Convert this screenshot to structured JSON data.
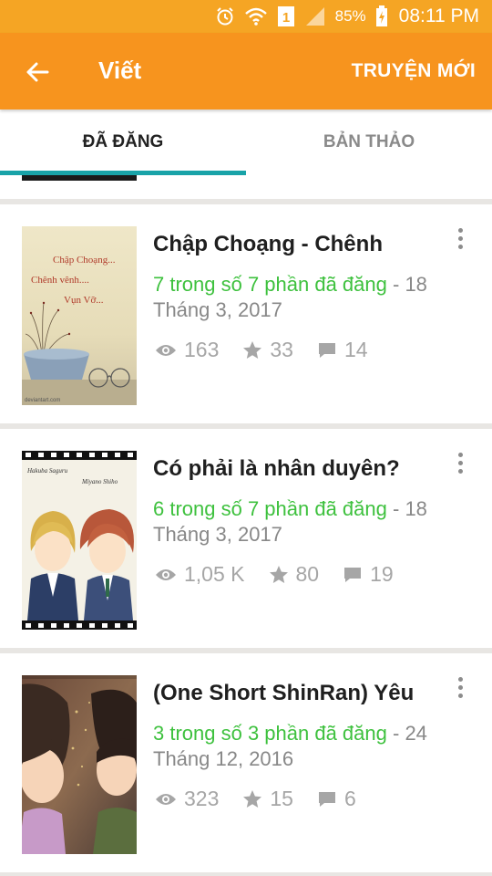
{
  "status_bar": {
    "icons": [
      "alarm-icon",
      "wifi-icon",
      "sim-1-icon",
      "signal-icon",
      "battery-charging-icon"
    ],
    "sim_label": "1",
    "battery": "85%",
    "time": "08:11 PM"
  },
  "app_bar": {
    "back_icon": "arrow-left-icon",
    "title": "Viết",
    "action": "TRUYỆN MỚI"
  },
  "tabs": [
    {
      "label": "ĐÃ ĐĂNG",
      "active": true
    },
    {
      "label": "BẢN THẢO",
      "active": false
    }
  ],
  "colors": {
    "app_bar": "#f7941e",
    "status_bar": "#f5a524",
    "tab_indicator": "#19a3a8",
    "published_text": "#3ec13e"
  },
  "stories": [
    {
      "title": "Chập Choạng - Chênh",
      "parts": "7 trong số 7 phần đã đăng",
      "date": " - 18 Tháng 3, 2017",
      "views": "163",
      "votes": "33",
      "comments": "14",
      "cover_text": [
        "Chập Choạng...",
        "Chênh vênh....",
        "Vụn Vỡ..."
      ],
      "cover_caption": "deviantart.com"
    },
    {
      "title": "Có phải là nhân duyên?",
      "parts": "6 trong số 7 phần đã đăng",
      "date": " - 18 Tháng 3, 2017",
      "views": "1,05 K",
      "votes": "80",
      "comments": "19",
      "cover_text": [
        "Hakuba Saguru",
        "Miyano Shiho"
      ]
    },
    {
      "title": "(One Short ShinRan) Yêu",
      "parts": "3 trong số 3 phần đã đăng",
      "date": " - 24 Tháng 12, 2016",
      "views": "323",
      "votes": "15",
      "comments": "6"
    }
  ]
}
